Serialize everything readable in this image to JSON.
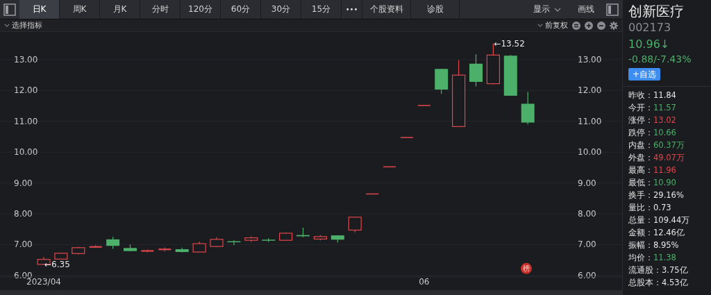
{
  "toolbar": {
    "tabs": [
      {
        "label": "日K",
        "selected": true
      },
      {
        "label": "周K",
        "selected": false
      },
      {
        "label": "月K",
        "selected": false
      },
      {
        "label": "分时",
        "selected": false
      },
      {
        "label": "120分",
        "selected": false
      },
      {
        "label": "60分",
        "selected": false
      },
      {
        "label": "30分",
        "selected": false
      },
      {
        "label": "15分",
        "selected": false
      }
    ],
    "more": "•••",
    "extra_tabs": [
      "个股资料",
      "诊股"
    ],
    "display_menu": "显示",
    "draw_button": "画线"
  },
  "indicator_bar": {
    "select_indicator": "选择指标",
    "adjust": "前复权"
  },
  "chart": {
    "left_price_labels": [
      "13.00",
      "12.00",
      "11.00",
      "10.00",
      "9.00",
      "8.00",
      "7.00",
      "6.00"
    ],
    "right_price_labels": [
      "13.00",
      "12.00",
      "11.00",
      "10.00",
      "9.00",
      "8.00",
      "7.00",
      "6.00"
    ],
    "date_labels": [
      "2023/04",
      "06"
    ],
    "high_marker": "←13.52",
    "low_marker": "←6.35",
    "badge": "榜"
  },
  "quote": {
    "name": "创新医疗",
    "code": "002173",
    "price": "10.96↓",
    "change": "-0.88/-7.43%",
    "watch_button": "+自选",
    "stats": [
      {
        "label": "昨收：",
        "value": "11.84",
        "color": "#e6e6e6"
      },
      {
        "label": "今开：",
        "value": "11.57",
        "color": "#4caf6a"
      },
      {
        "label": "涨停：",
        "value": "13.02",
        "color": "#e0474c"
      },
      {
        "label": "跌停：",
        "value": "10.66",
        "color": "#4caf6a"
      },
      {
        "label": "内盘：",
        "value": "60.37万",
        "color": "#4caf6a"
      },
      {
        "label": "外盘：",
        "value": "49.07万",
        "color": "#e0474c"
      },
      {
        "label": "最高：",
        "value": "11.96",
        "color": "#e0474c"
      },
      {
        "label": "最低：",
        "value": "10.90",
        "color": "#4caf6a"
      },
      {
        "label": "换手：",
        "value": "29.16%",
        "color": "#e6e6e6"
      },
      {
        "label": "量比：",
        "value": "0.73",
        "color": "#e6e6e6"
      },
      {
        "label": "总量：",
        "value": "109.44万",
        "color": "#e6e6e6"
      },
      {
        "label": "金额：",
        "value": "12.46亿",
        "color": "#e6e6e6"
      },
      {
        "label": "振幅：",
        "value": "8.95%",
        "color": "#e6e6e6"
      },
      {
        "label": "均价：",
        "value": "11.38",
        "color": "#4caf6a"
      },
      {
        "label": "流通股：",
        "value": "3.75亿",
        "color": "#e6e6e6"
      },
      {
        "label": "总股本：",
        "value": "4.53亿",
        "color": "#e6e6e6"
      }
    ]
  }
}
